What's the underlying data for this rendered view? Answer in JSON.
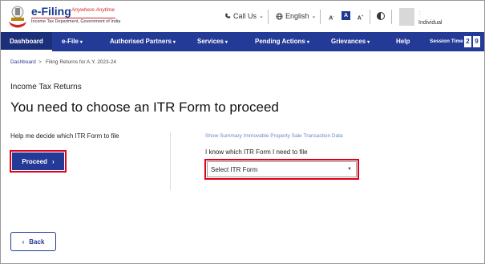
{
  "header": {
    "logo_title": "e-Filing",
    "logo_tagline": "Anywhere Anytime",
    "logo_subtitle": "Income Tax Department, Government of India",
    "call_us": "Call Us",
    "language": "English",
    "font_small": "A",
    "font_normal": "A",
    "font_large": "A",
    "user_colon": ":",
    "user_role": "Individual"
  },
  "nav": {
    "items": [
      {
        "label": "Dashboard"
      },
      {
        "label": "e-File"
      },
      {
        "label": "Authorised Partners"
      },
      {
        "label": "Services"
      },
      {
        "label": "Pending Actions"
      },
      {
        "label": "Grievances"
      },
      {
        "label": "Help"
      }
    ],
    "session_label": "Session Time",
    "session_digits": [
      "2",
      "9"
    ]
  },
  "breadcrumb": {
    "home": "Dashboard",
    "separator": ">",
    "current": "Filing Returns for A.Y. 2023-24"
  },
  "main": {
    "subtitle": "Income Tax Returns",
    "title": "You need to choose an ITR Form to proceed",
    "help_text": "Help me decide which ITR Form to file",
    "proceed_label": "Proceed",
    "proceed_arrow": "›",
    "summary_link": "Show Summary Immovable Property Sale Transaction Data",
    "know_label": "I know which ITR Form I need to file",
    "select_value": "Select ITR Form",
    "back_label": "Back",
    "back_arrow": "‹"
  },
  "colors": {
    "brand_blue": "#233a96",
    "highlight_red": "#e0001b"
  }
}
